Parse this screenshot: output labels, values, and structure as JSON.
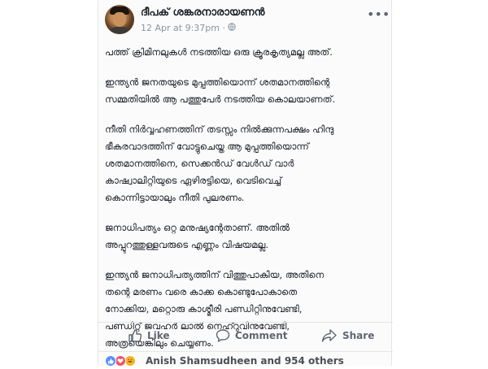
{
  "post": {
    "author": "ദീപക് ശങ്കരനാരായണൻ",
    "timestamp": "12 Apr at 9:37pm",
    "audience_separator": "·",
    "more_glyph": "•••",
    "paragraphs": [
      "പത്ത് ക്രിമിനലുകൾ നടത്തിയ ഒരു ക്രൂരകൃത്യമല്ല അത്.",
      "  ഇന്ത്യൻ ജനതയുടെ മുപ്പത്തിയൊന്ന് ശതമാനത്തിന്റെ\nസമ്മതിയിൽ ആ പത്തുപേർ നടത്തിയ കൊലയാണത്.",
      "നീതി നിർവ്വഹണത്തിന് തടസ്സം നിൽക്കുന്നപക്ഷം  ഹിന്ദു\nഭീകരവാദത്തിന് വോട്ടുചെയ്ത ആ മുപ്പത്തിയൊന്ന്\nശതമാനത്തിനെ, സെക്കൻഡ് വേൾഡ് വാർ\nകാഷ്വാലിറ്റിയുടെ ഏഴിരട്ടിയെ, വെടിവെച്ച്\nകൊന്നിട്ടായാലും നീതി പുലരണം.",
      "ജനാധിപത്യം ഒറ്റ മനുഷ്യന്റേതാണ്. അതിൽ\nഅപ്പുറത്തുള്ളവരുടെ എണ്ണം വിഷയമല്ല.",
      "ഇന്ത്യൻ ജനാധിപത്യത്തിന് വിത്തുപാകിയ, അതിനെ\nതന്റെ മരണം വരെ കാക്ക കൊണ്ടുപോകാതെ\nനോക്കിയ, മറ്റൊരു കാശ്മീരി പണ്ഡിറ്റിനുവേണ്ടി,\nപണ്ഡിറ്റ് ജവഹർ ലാൽ നെഹ്റുവിനുവേണ്ടി,\nഅത്രയെങ്കിലും ചെയ്യണം."
    ]
  },
  "actions": {
    "like": "Like",
    "comment": "Comment",
    "share": "Share"
  },
  "reactions": {
    "summary": "Anish Shamsudheen and 954 others",
    "icons": [
      "like-icon",
      "love-icon",
      "haha-icon"
    ],
    "colors": {
      "like": "#5890ff",
      "love": "#f25268",
      "haha": "#f7b125"
    }
  },
  "colors": {
    "text": "#1d2129",
    "muted": "#8d949e",
    "action": "#606770"
  }
}
